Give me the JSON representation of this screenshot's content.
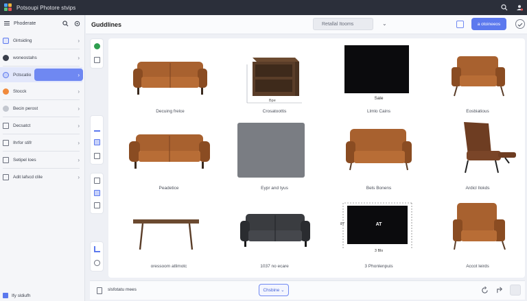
{
  "window": {
    "title": "Potsoupi Photore stvips"
  },
  "sidebar": {
    "title": "Phoderate",
    "items": [
      {
        "label": "Glrtsiding",
        "icon": "layers-icon",
        "color": "#5c79ee"
      },
      {
        "label": "woneostahs",
        "icon": "circle-dark-icon",
        "color": "#3a3f4b"
      },
      {
        "label": "Pctscatio",
        "icon": "palette-icon",
        "color": "#5c79ee",
        "active": true
      },
      {
        "label": "Stocck",
        "icon": "orange-dot-icon",
        "color": "#f08a3c"
      },
      {
        "label": "Becin perost",
        "icon": "gray-dot-icon",
        "color": "#9aa0ab"
      },
      {
        "label": "Decsatct",
        "icon": "box-icon",
        "color": "#6a6f7c"
      },
      {
        "label": "Ihrfor stifr",
        "icon": "book-icon",
        "color": "#6a6f7c"
      },
      {
        "label": "Setipel loes",
        "icon": "list-icon",
        "color": "#6a6f7c"
      },
      {
        "label": "Adit lafscd clile",
        "icon": "edit-icon",
        "color": "#6a6f7c"
      }
    ],
    "footer": "Ify sldiufh"
  },
  "header": {
    "title": "Guddlines",
    "search_value": "Retallal Itooms",
    "primary_button": "a otoineeos"
  },
  "grid": [
    {
      "caption": "Decuing frelce",
      "kind": "sofa-brown"
    },
    {
      "caption": "Crosatoottis",
      "kind": "cabinet",
      "dim": "Bpe"
    },
    {
      "caption": "Llmlo Cains",
      "kind": "black-panel",
      "label": "Sale"
    },
    {
      "caption": "Eosbiatious",
      "kind": "armchair-brown"
    },
    {
      "caption": "Peadetice",
      "kind": "sofa-brown-2"
    },
    {
      "caption": "Eypr and tyus",
      "kind": "gray-panel"
    },
    {
      "caption": "Bels Bonens",
      "kind": "loveseat-brown"
    },
    {
      "caption": "Ardicl Ilokds",
      "kind": "recliner"
    },
    {
      "caption": "oressoom atlimotc",
      "kind": "table"
    },
    {
      "caption": "1037 no ecare",
      "kind": "sofa-black"
    },
    {
      "caption": "3 Phonlenpuis",
      "kind": "black-measure",
      "label": "AT",
      "dim_left": "87",
      "dim_bottom": "3 Bls"
    },
    {
      "caption": "Accot leirds",
      "kind": "armchair-brown-2"
    }
  ],
  "bottom": {
    "label": "slsfotatu mees",
    "button": "Chsbine"
  },
  "colors": {
    "accent": "#5c79ee",
    "leather": "#a8612f",
    "leatherDark": "#7a4320",
    "wood": "#5a3d28"
  }
}
